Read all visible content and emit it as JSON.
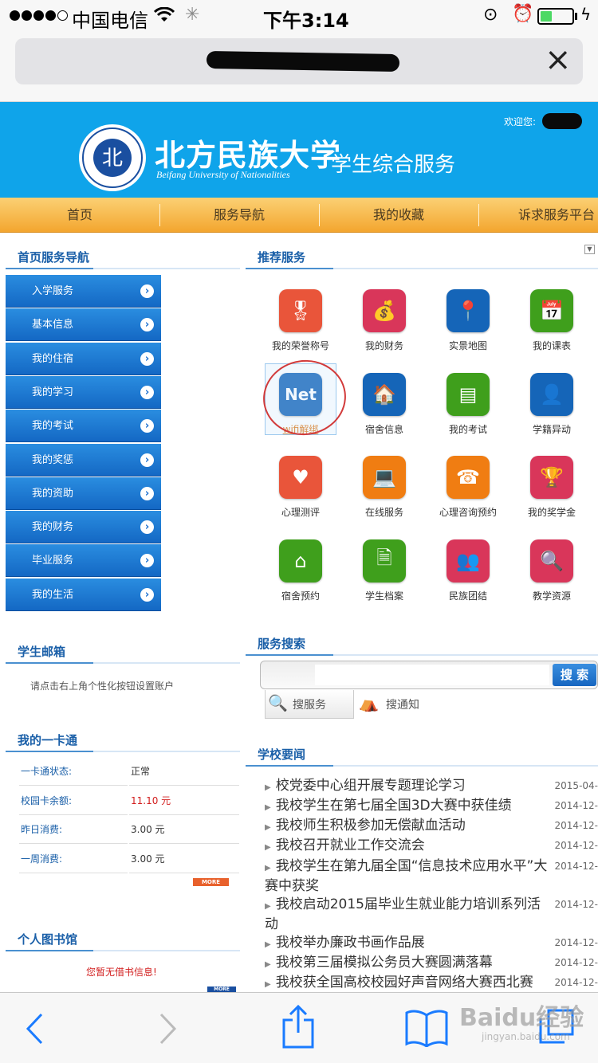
{
  "status": {
    "carrier": "中国电信",
    "time": "下午3:14"
  },
  "browser": {
    "close": "×"
  },
  "header": {
    "title_cn": "北方民族大学",
    "title_en": "Beifang University of Nationalities",
    "subtitle": "学生综合服务",
    "welcome": "欢迎您:"
  },
  "nav": [
    "首页",
    "服务导航",
    "我的收藏",
    "诉求服务平台"
  ],
  "left_nav": {
    "title": "首页服务导航",
    "items": [
      "入学服务",
      "基本信息",
      "我的住宿",
      "我的学习",
      "我的考试",
      "我的奖惩",
      "我的资助",
      "我的财务",
      "毕业服务",
      "我的生活"
    ]
  },
  "recommend": {
    "title": "推荐服务",
    "items": [
      {
        "label": "我的荣誉称号",
        "color": "#e9553a",
        "icon": "award-icon"
      },
      {
        "label": "我的财务",
        "color": "#d9365a",
        "icon": "coins-icon"
      },
      {
        "label": "实景地图",
        "color": "#1565b8",
        "icon": "map-icon"
      },
      {
        "label": "我的课表",
        "color": "#3f9f1c",
        "icon": "calendar-icon"
      },
      {
        "label": "wifi解绑",
        "color": "#1565b8",
        "icon": "net-icon"
      },
      {
        "label": "宿舍信息",
        "color": "#1565b8",
        "icon": "dorm-icon"
      },
      {
        "label": "我的考试",
        "color": "#3f9f1c",
        "icon": "id-card-icon"
      },
      {
        "label": "学籍异动",
        "color": "#1565b8",
        "icon": "student-info-icon"
      },
      {
        "label": "心理测评",
        "color": "#e9553a",
        "icon": "heart-icon"
      },
      {
        "label": "在线服务",
        "color": "#f07d12",
        "icon": "laptop-icon"
      },
      {
        "label": "心理咨询预约",
        "color": "#f07d12",
        "icon": "phone-heart-icon"
      },
      {
        "label": "我的奖学金",
        "color": "#d9365a",
        "icon": "trophy-icon"
      },
      {
        "label": "宿舍预约",
        "color": "#3f9f1c",
        "icon": "house-check-icon"
      },
      {
        "label": "学生档案",
        "color": "#3f9f1c",
        "icon": "file-search-icon"
      },
      {
        "label": "民族团结",
        "color": "#d9365a",
        "icon": "people-icon"
      },
      {
        "label": "教学资源",
        "color": "#d9365a",
        "icon": "resource-search-icon"
      }
    ]
  },
  "mailbox": {
    "title": "学生邮箱",
    "hint": "请点击右上角个性化按钮设置账户"
  },
  "search": {
    "title": "服务搜索",
    "button": "搜 索",
    "tab1": "搜服务",
    "tab2": "搜通知",
    "value": ""
  },
  "card": {
    "title": "我的一卡通",
    "rows": [
      {
        "k": "一卡通状态:",
        "v": "正常"
      },
      {
        "k": "校园卡余额:",
        "v": "11.10 元"
      },
      {
        "k": "昨日消费:",
        "v": "3.00 元"
      },
      {
        "k": "一周消费:",
        "v": "3.00 元"
      }
    ],
    "more": "MORE"
  },
  "news": {
    "title": "学校要闻",
    "items": [
      {
        "text": "校党委中心组开展专题理论学习",
        "date": "2015-04-"
      },
      {
        "text": "我校学生在第七届全国3D大赛中获佳绩",
        "date": "2014-12-"
      },
      {
        "text": "我校师生积极参加无偿献血活动",
        "date": "2014-12-"
      },
      {
        "text": "我校召开就业工作交流会",
        "date": "2014-12-"
      },
      {
        "text": "我校学生在第九届全国“信息技术应用水平”大赛中获奖",
        "date": "2014-12-"
      },
      {
        "text": "我校启动2015届毕业生就业能力培训系列活动",
        "date": "2014-12-"
      },
      {
        "text": "我校举办廉政书画作品展",
        "date": "2014-12-"
      },
      {
        "text": "我校第三届模拟公务员大赛圆满落幕",
        "date": "2014-12-"
      },
      {
        "text": "我校获全国高校校园好声音网络大赛西北赛",
        "date": "2014-12-"
      }
    ]
  },
  "library": {
    "title": "个人图书馆",
    "message": "您暂无借书信息!",
    "more": "MORE"
  },
  "watermark": {
    "text": "Baidu经验",
    "sub": "jingyan.baidu.com"
  }
}
